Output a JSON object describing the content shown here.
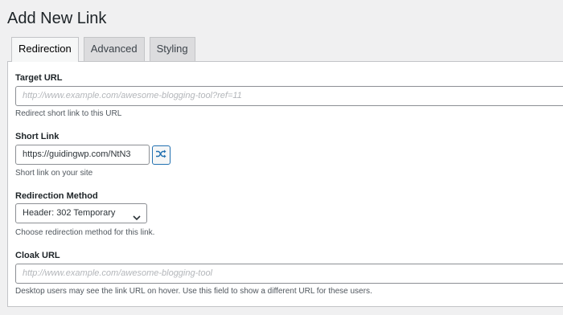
{
  "page": {
    "title": "Add New Link"
  },
  "tabs": [
    {
      "label": "Redirection",
      "active": true
    },
    {
      "label": "Advanced",
      "active": false
    },
    {
      "label": "Styling",
      "active": false
    }
  ],
  "fields": {
    "target_url": {
      "label": "Target URL",
      "placeholder": "http://www.example.com/awesome-blogging-tool?ref=11",
      "value": "",
      "help": "Redirect short link to this URL"
    },
    "short_link": {
      "label": "Short Link",
      "value": "https://guidingwp.com/NtN3",
      "help": "Short link on your site",
      "shuffle_icon": "shuffle-icon"
    },
    "redirection_method": {
      "label": "Redirection Method",
      "selected": "Header: 302 Temporary",
      "help": "Choose redirection method for this link."
    },
    "cloak_url": {
      "label": "Cloak URL",
      "placeholder": "http://www.example.com/awesome-blogging-tool",
      "value": "",
      "help": "Desktop users may see the link URL on hover. Use this field to show a different URL for these users."
    }
  },
  "colors": {
    "accent": "#2271b1",
    "background": "#f0f0f1",
    "panel": "#ffffff",
    "border": "#c3c4c7"
  }
}
